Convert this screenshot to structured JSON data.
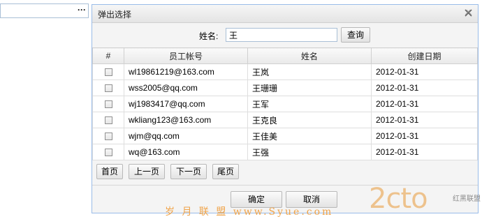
{
  "field": {
    "more_label": "···"
  },
  "dialog": {
    "title": "弹出选择",
    "close_icon": "close-icon",
    "search": {
      "label": "姓名:",
      "value": "王",
      "button": "查询"
    },
    "table": {
      "columns": [
        "#",
        "员工帐号",
        "姓名",
        "创建日期"
      ],
      "rows": [
        {
          "account": "wl19861219@163.com",
          "name": "王岚",
          "date": "2012-01-31"
        },
        {
          "account": "wss2005@qq.com",
          "name": "王珊珊",
          "date": "2012-01-31"
        },
        {
          "account": "wj1983417@qq.com",
          "name": "王军",
          "date": "2012-01-31"
        },
        {
          "account": "wkliang123@163.com",
          "name": "王克良",
          "date": "2012-01-31"
        },
        {
          "account": "wjm@qq.com",
          "name": "王佳美",
          "date": "2012-01-31"
        },
        {
          "account": "wq@163.com",
          "name": "王强",
          "date": "2012-01-31"
        }
      ]
    },
    "pager": {
      "first": "首页",
      "prev": "上一页",
      "next": "下一页",
      "last": "尾页"
    },
    "footer": {
      "ok": "确定",
      "cancel": "取消"
    }
  },
  "watermark": {
    "site": "岁 月 联 盟 www.Syue.com",
    "logo": "2cto",
    "logo_tag": "红黑联盟"
  }
}
